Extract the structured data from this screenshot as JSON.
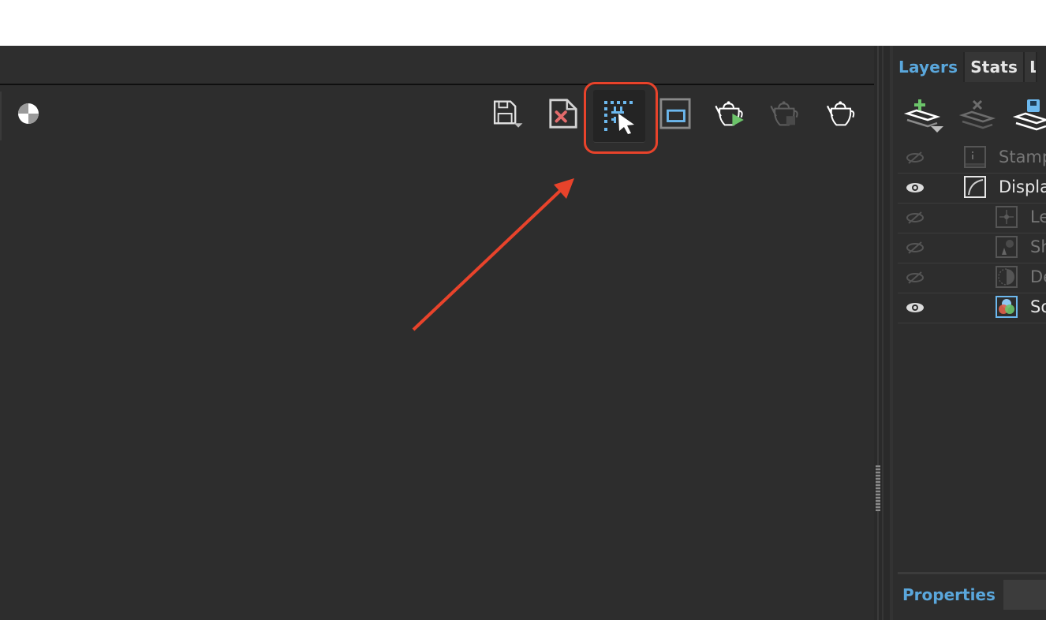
{
  "viewport": {
    "toolbar": {
      "left_icon": "color-checker-icon",
      "buttons": [
        {
          "id": "save-image",
          "icon": "floppy-dropdown-icon",
          "label": "Save image"
        },
        {
          "id": "clear-image",
          "icon": "file-x-icon",
          "label": "Clear image"
        },
        {
          "id": "region-select",
          "icon": "region-select-cursor-icon",
          "label": "Region select",
          "state": "selected"
        },
        {
          "id": "frame-region",
          "icon": "frame-rect-icon",
          "label": "Frame region"
        },
        {
          "id": "start-render",
          "icon": "teapot-play-icon",
          "label": "Start render"
        },
        {
          "id": "stop-render",
          "icon": "teapot-stop-icon",
          "label": "Stop render",
          "state": "disabled"
        },
        {
          "id": "render-teapot",
          "icon": "teapot-icon",
          "label": "Render"
        }
      ]
    }
  },
  "annotation": {
    "color": "#e8432b",
    "target": "region-select"
  },
  "panel": {
    "tabs": [
      {
        "label": "Layers",
        "state": "active"
      },
      {
        "label": "Stats",
        "state": "inactive"
      },
      {
        "label": "L",
        "state": "partial"
      }
    ],
    "toolbar": [
      {
        "icon": "add-layer-icon",
        "label": "Add layer"
      },
      {
        "icon": "delete-layer-icon",
        "label": "Delete layer",
        "state": "disabled"
      },
      {
        "icon": "save-layers-icon",
        "label": "Save layers"
      }
    ],
    "layers": [
      {
        "name": "Stamp",
        "visible": false,
        "indent": 0,
        "thumb": "info-stamp-icon",
        "dim": true
      },
      {
        "name": "Display",
        "visible": true,
        "indent": 0,
        "thumb": "curve-icon",
        "dim": false
      },
      {
        "name": "Le",
        "visible": false,
        "indent": 1,
        "thumb": "lens-flare-icon",
        "dim": true
      },
      {
        "name": "Sh",
        "visible": false,
        "indent": 1,
        "thumb": "sharpen-icon",
        "dim": true
      },
      {
        "name": "De",
        "visible": false,
        "indent": 1,
        "thumb": "denoise-icon",
        "dim": true
      },
      {
        "name": "So",
        "visible": true,
        "indent": 1,
        "thumb": "source-rgb-icon",
        "dim": false
      }
    ],
    "properties_label": "Properties"
  },
  "colors": {
    "accent_blue": "#5aa7dc",
    "background": "#2d2d2d",
    "annotation_red": "#e8432b",
    "play_green": "#6cc46a"
  }
}
